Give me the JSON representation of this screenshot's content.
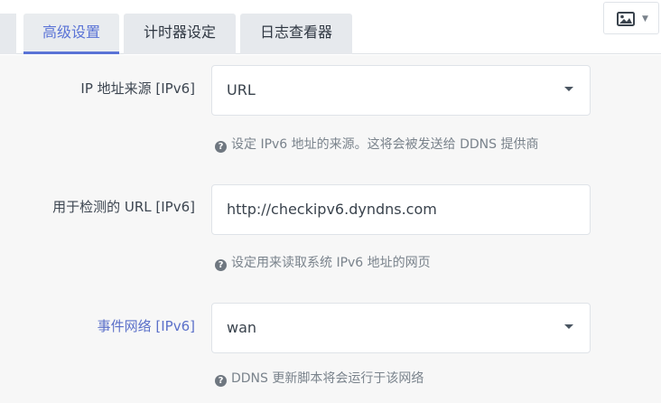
{
  "tabs": [
    {
      "label": "高级设置",
      "active": true
    },
    {
      "label": "计时器设定",
      "active": false
    },
    {
      "label": "日志查看器",
      "active": false
    }
  ],
  "toolbar": {
    "image_toggle_icon": "image-icon",
    "caret_icon": "caret-down-icon"
  },
  "fields": [
    {
      "label": "IP 地址来源 [IPv6]",
      "type": "select",
      "value": "URL",
      "help": "设定 IPv6 地址的来源。这将会被发送给 DDNS 提供商"
    },
    {
      "label": "用于检测的 URL [IPv6]",
      "type": "input",
      "value": "http://checkipv6.dyndns.com",
      "help": "设定用来读取系统 IPv6 地址的网页"
    },
    {
      "label": "事件网络 [IPv6]",
      "type": "select",
      "value": "wan",
      "help": "DDNS 更新脚本将会运行于该网络"
    }
  ],
  "colors": {
    "accent": "#5a73d6",
    "tab_bg": "#e6e9ed",
    "panel_bg": "#f7f7f7"
  }
}
